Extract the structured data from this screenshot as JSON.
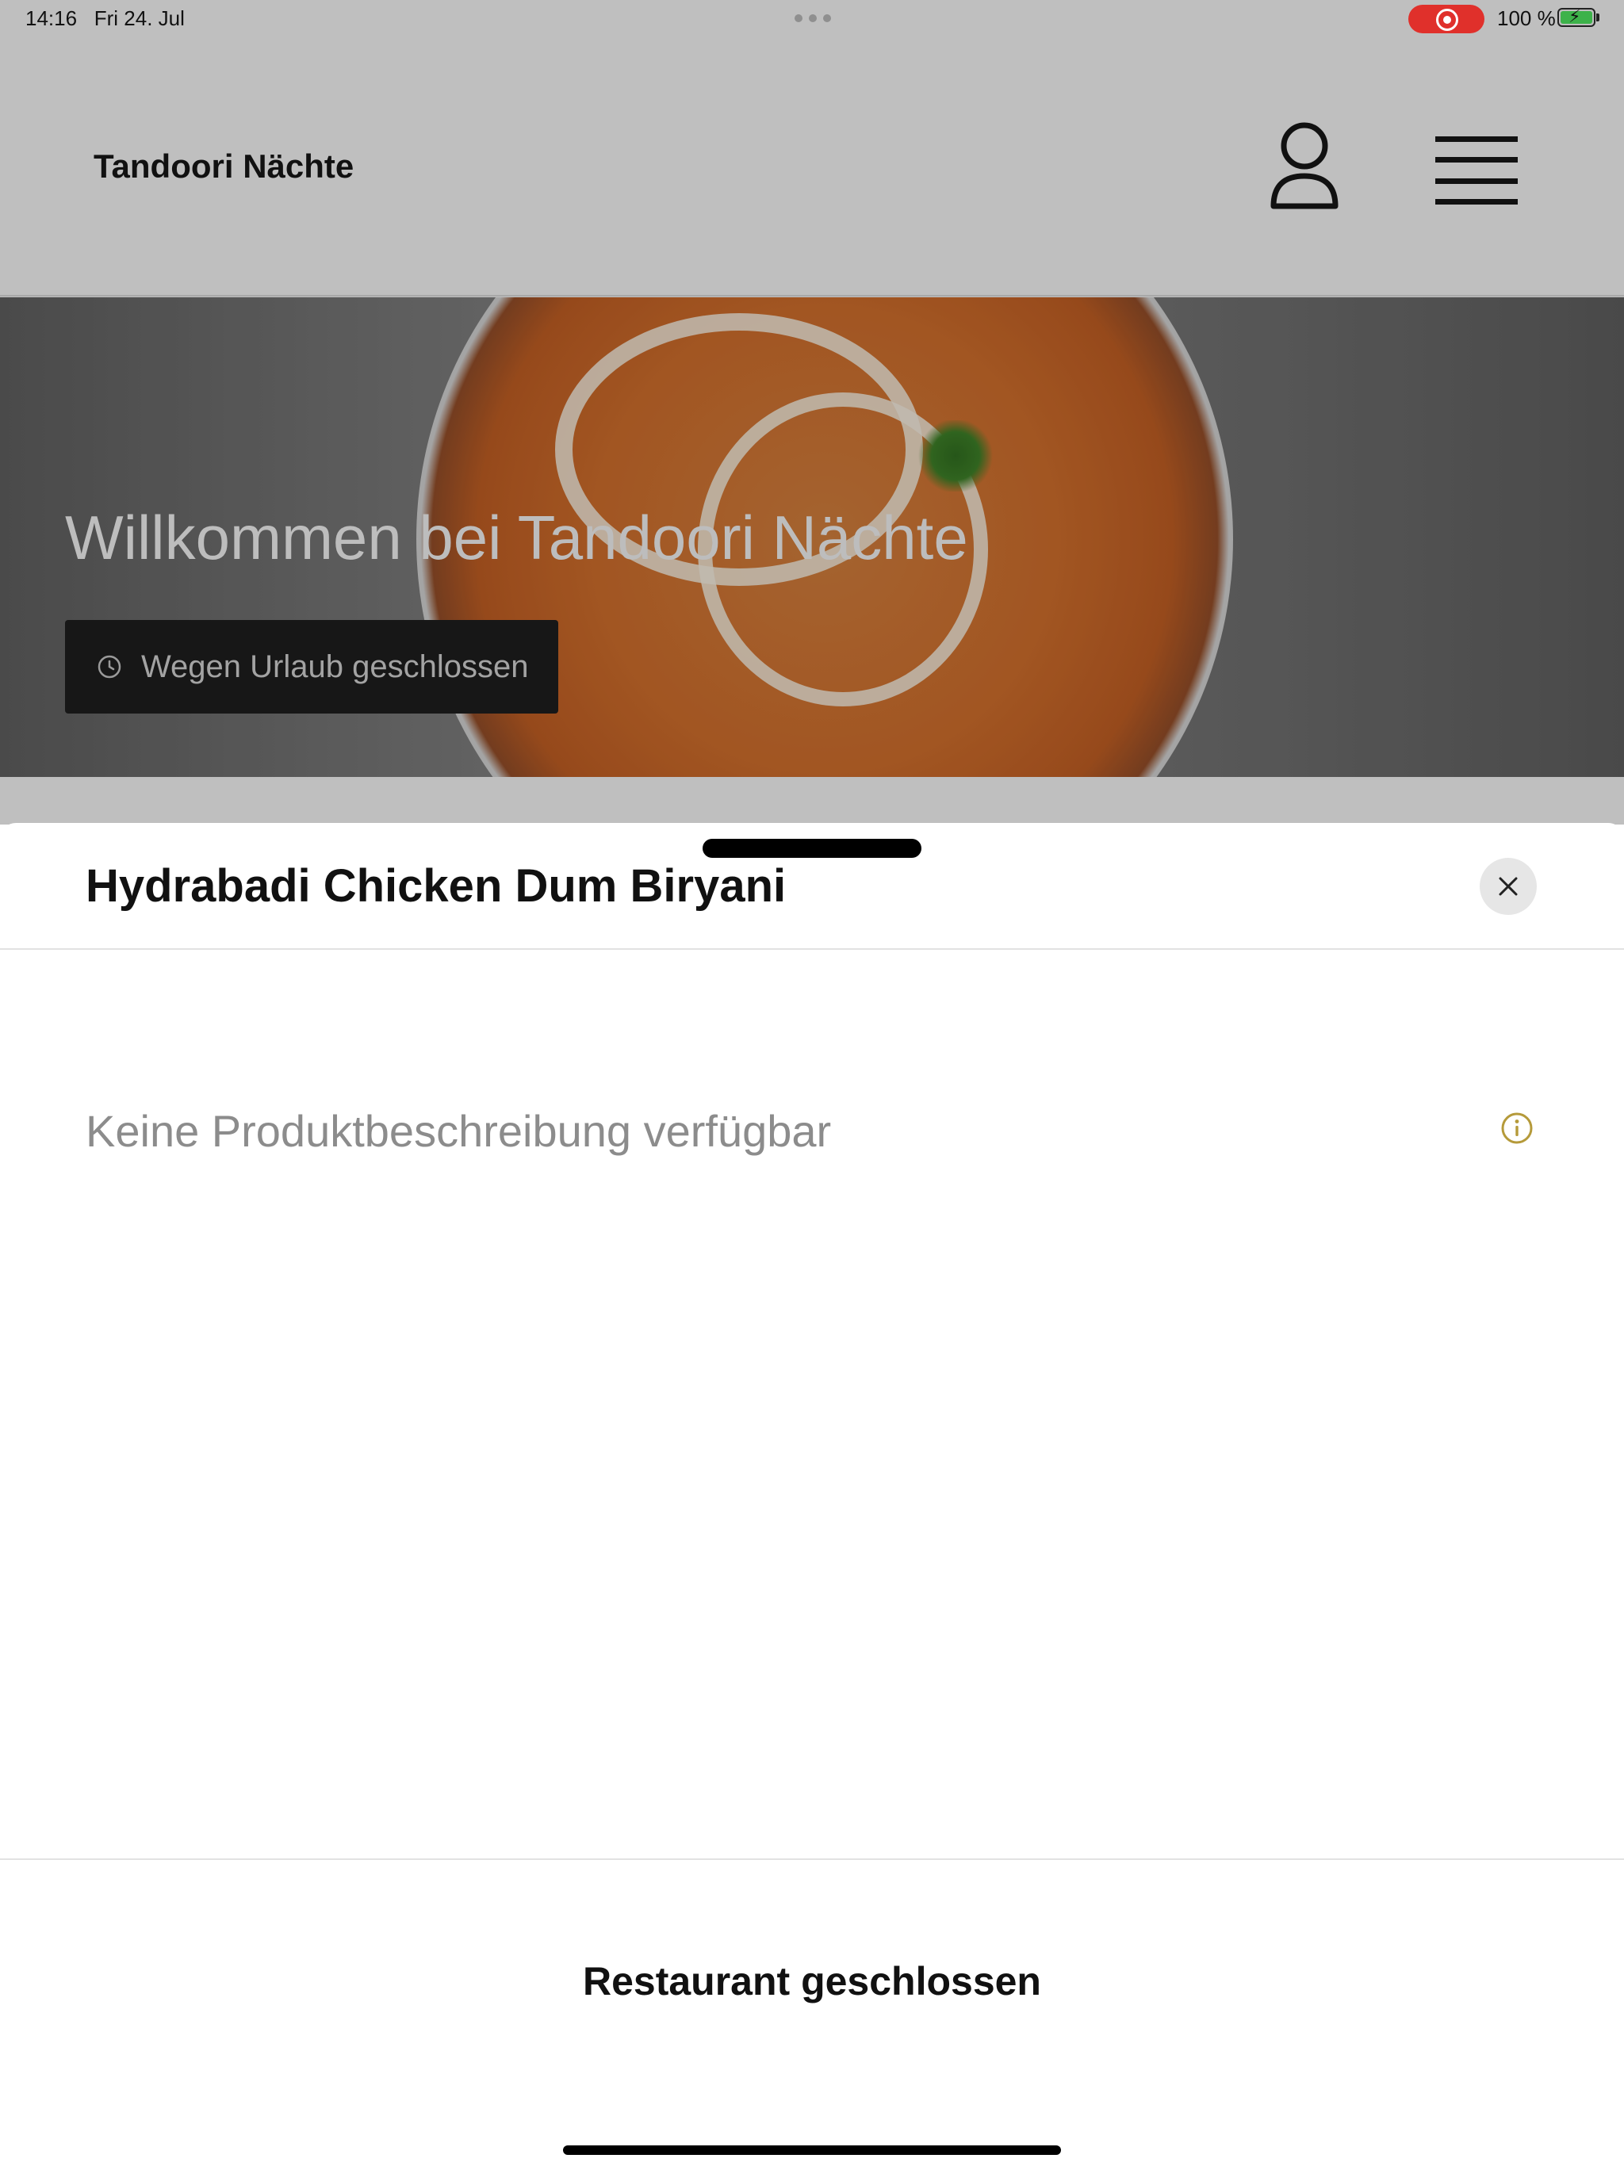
{
  "status_bar": {
    "time": "14:16",
    "date": "Fri 24. Jul",
    "battery_percent": "100 %",
    "recording_indicator_color": "#e0302b",
    "battery_color": "#3db24a"
  },
  "header": {
    "brand": "Tandoori Nächte",
    "account_icon": "person-icon",
    "menu_icon": "hamburger-menu-icon"
  },
  "hero": {
    "title": "Willkommen bei Tandoori Nächte",
    "status_label": "Wegen Urlaub geschlossen",
    "status_icon": "clock-icon"
  },
  "product_sheet": {
    "title": "Hydrabadi Chicken Dum Biryani",
    "description": "Keine Produktbeschreibung verfügbar",
    "info_icon_color": "#b59a3a",
    "footer_status": "Restaurant geschlossen"
  }
}
